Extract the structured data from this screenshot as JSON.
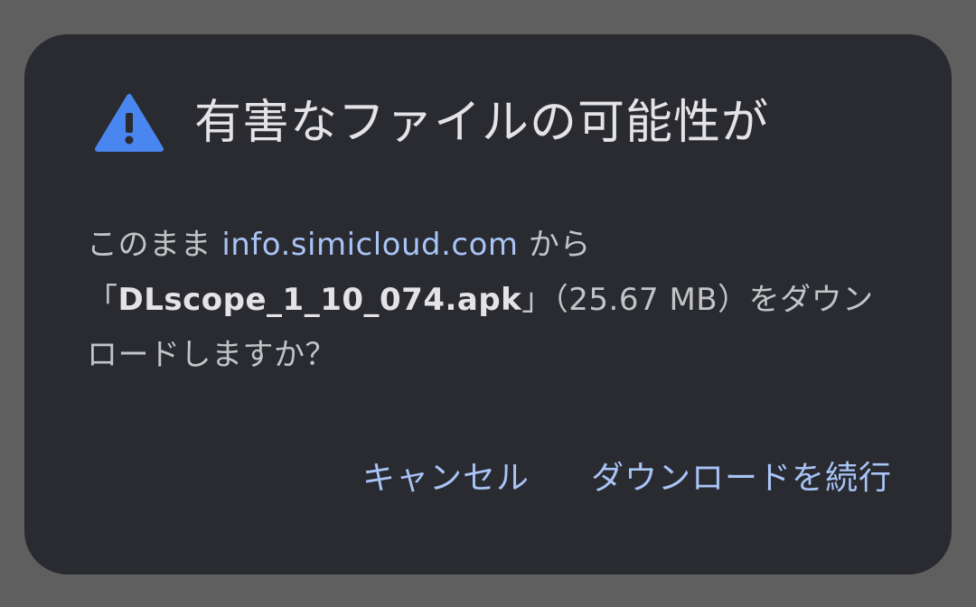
{
  "dialog": {
    "title": "有害なファイルの可能性が",
    "icon": "warning-triangle-icon",
    "accent_color": "#4285f4",
    "message": {
      "line1_prefix": "このまま ",
      "domain": "info.simicloud.com",
      "line1_suffix": " から",
      "file_open": "「",
      "file_name": "DLscope_1_10_074.apk",
      "file_close": "」",
      "file_size": "（25.67 MB）",
      "line2_suffix": "をダウン",
      "line3": "ロードしますか？"
    },
    "buttons": {
      "cancel": "キャンセル",
      "continue": "ダウンロードを続行"
    }
  }
}
